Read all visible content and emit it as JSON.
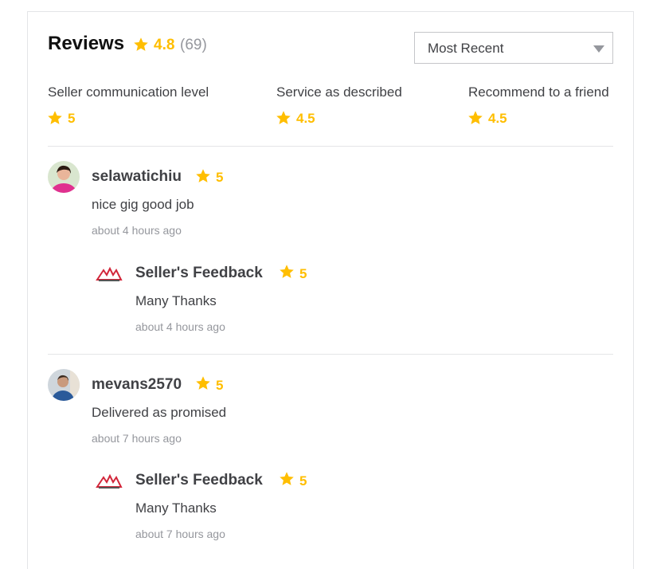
{
  "header": {
    "title": "Reviews",
    "rating": "4.8",
    "count": "(69)",
    "sort_selected": "Most Recent"
  },
  "categories": [
    {
      "label": "Seller communication level",
      "value": "5"
    },
    {
      "label": "Service as described",
      "value": "4.5"
    },
    {
      "label": "Recommend to a friend",
      "value": "4.5"
    }
  ],
  "reviews": [
    {
      "username": "selawatichiu",
      "rating": "5",
      "comment": "nice gig good job",
      "time": "about 4 hours ago",
      "reply": {
        "title": "Seller's Feedback",
        "rating": "5",
        "comment": "Many Thanks",
        "time": "about 4 hours ago"
      }
    },
    {
      "username": "mevans2570",
      "rating": "5",
      "comment": "Delivered as promised",
      "time": "about 7 hours ago",
      "reply": {
        "title": "Seller's Feedback",
        "rating": "5",
        "comment": "Many Thanks",
        "time": "about 7 hours ago"
      }
    }
  ],
  "colors": {
    "star": "#ffbe00",
    "text": "#404145",
    "muted": "#95979d",
    "divider": "#e4e5e7"
  },
  "icons": {
    "star": "star-icon",
    "caret": "chevron-down-icon"
  }
}
